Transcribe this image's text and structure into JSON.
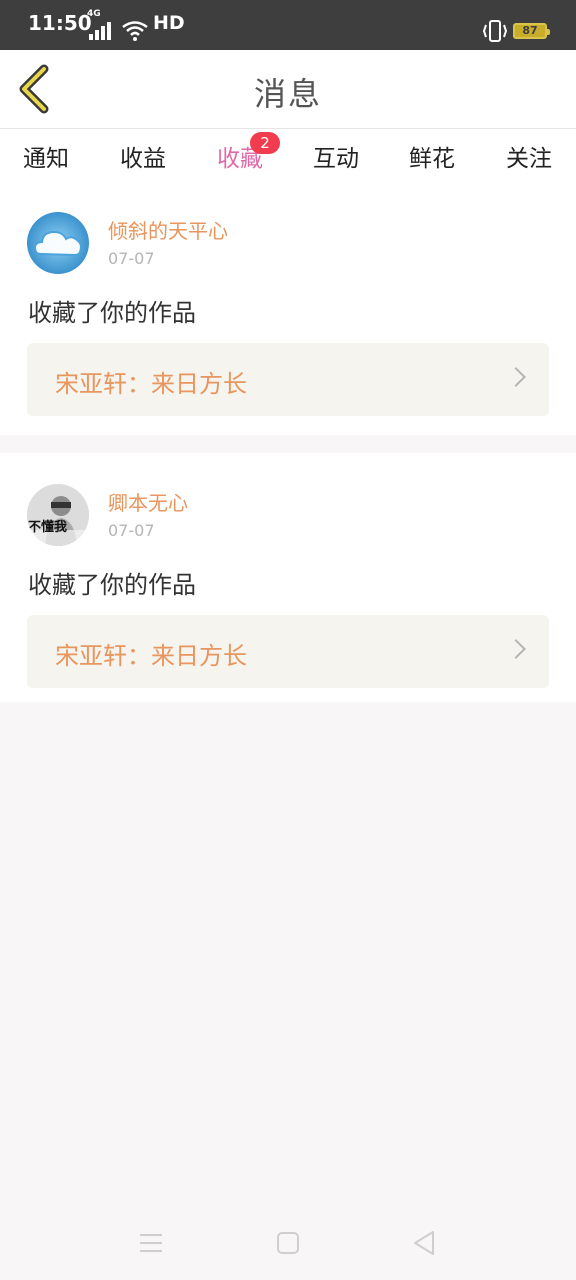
{
  "status_bar": {
    "time": "11:50",
    "network": "4G",
    "hd": "HD",
    "battery": "87"
  },
  "header": {
    "title": "消息"
  },
  "tabs": [
    {
      "label": "通知"
    },
    {
      "label": "收益"
    },
    {
      "label": "收藏",
      "badge": "2",
      "active": true
    },
    {
      "label": "互动"
    },
    {
      "label": "鲜花"
    },
    {
      "label": "关注"
    }
  ],
  "messages": [
    {
      "username": "倾斜的天平心",
      "date": "07-07",
      "action": "收藏了你的作品",
      "work": "宋亚轩：来日方长",
      "avatar": "cloud-avatar"
    },
    {
      "username": "卿本无心",
      "date": "07-07",
      "action": "收藏了你的作品",
      "work": "宋亚轩：来日方长",
      "avatar": "photo-avatar",
      "avatar_caption": "不懂我"
    }
  ],
  "colors": {
    "accent": "#e06ba8",
    "badge": "#f03c4e",
    "username": "#e8955e",
    "status_bar": "#3e3e3e"
  }
}
